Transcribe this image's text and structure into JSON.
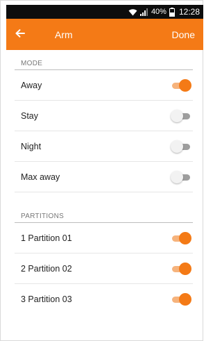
{
  "status_bar": {
    "battery_percent": "40%",
    "time": "12:28",
    "icons": [
      "wifi-icon",
      "signal-icon",
      "battery-icon"
    ]
  },
  "app_bar": {
    "back_icon": "arrow-left-icon",
    "title": "Arm",
    "done_label": "Done",
    "color": "#f47a16"
  },
  "mode": {
    "header": "MODE",
    "items": [
      {
        "label": "Away",
        "on": true
      },
      {
        "label": "Stay",
        "on": false
      },
      {
        "label": "Night",
        "on": false
      },
      {
        "label": "Max away",
        "on": false
      }
    ]
  },
  "partitions": {
    "header": "PARTITIONS",
    "items": [
      {
        "label": "1 Partition 01",
        "on": true
      },
      {
        "label": "2 Partition 02",
        "on": true
      },
      {
        "label": "3 Partition 03",
        "on": true
      }
    ]
  }
}
